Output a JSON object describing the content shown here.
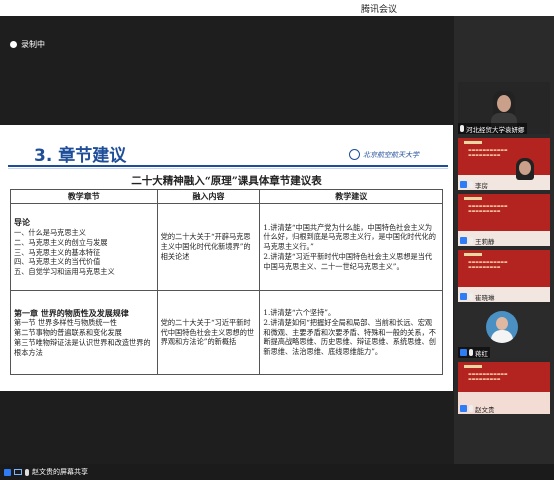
{
  "app": {
    "title": "腾讯会议"
  },
  "status": {
    "recording": "录制中"
  },
  "slide": {
    "title": "3. 章节建议",
    "logo_text": "北京航空航天大学",
    "table_title": "二十大精神融入“原理”课具体章节建议表",
    "headers": [
      "教学章节",
      "融入内容",
      "教学建议"
    ],
    "rows": [
      {
        "chapter_lead": "导论",
        "chapter_lines": [
          "一、什么是马克思主义",
          "二、马克思主义的创立与发展",
          "三、马克思主义的基本特征",
          "四、马克思主义的当代价值",
          "五、自觉学习和运用马克思主义"
        ],
        "content": "党的二十大关于“开辟马克思主义中国化时代化新境界”的相关论述",
        "advice": [
          "1.讲清楚“中国共产党为什么能，中国特色社会主义为什么好，归根到底是马克思主义行，是中国化时代化的马克思主义行。”",
          "2.讲清楚“习近平新时代中国特色社会主义思想是当代中国马克思主义、二十一世纪马克思主义”。"
        ]
      },
      {
        "chapter_lead": "第一章 世界的物质性及发展规律",
        "chapter_lines": [
          "第一节 世界多样性与物质统一性",
          "第二节事物的普遍联系和变化发展",
          "第三节唯物辩证法是认识世界和改造世界的根本方法"
        ],
        "content": "党的二十大关于“习近平新时代中国特色社会主义思想的世界观和方法论”的新概括",
        "advice": [
          "1.讲清楚“六个坚持”。",
          "2.讲清楚如何“把握好全局和局部、当前和长远、宏观和微观、主要矛盾和次要矛盾、特殊和一般的关系，不断提高战略思维、历史思维、辩证思维、系统思维、创新思维、法治思维、底线思维能力”。"
        ]
      }
    ]
  },
  "participants": [
    {
      "name": "河北经贸大学袁妍娜",
      "kind": "camera"
    },
    {
      "name": "李房",
      "kind": "slide"
    },
    {
      "name": "王莉静",
      "kind": "slide"
    },
    {
      "name": "崔晓琳",
      "kind": "slide"
    },
    {
      "name": "蒋红",
      "kind": "avatar"
    },
    {
      "name": "赵文贵",
      "kind": "slide"
    }
  ],
  "bottom": {
    "share_label": "赵文贵的屏幕共享"
  },
  "colors": {
    "accent": "#2e7df6",
    "slide_title": "#1f4e99",
    "tile_red": "#b3231f"
  }
}
